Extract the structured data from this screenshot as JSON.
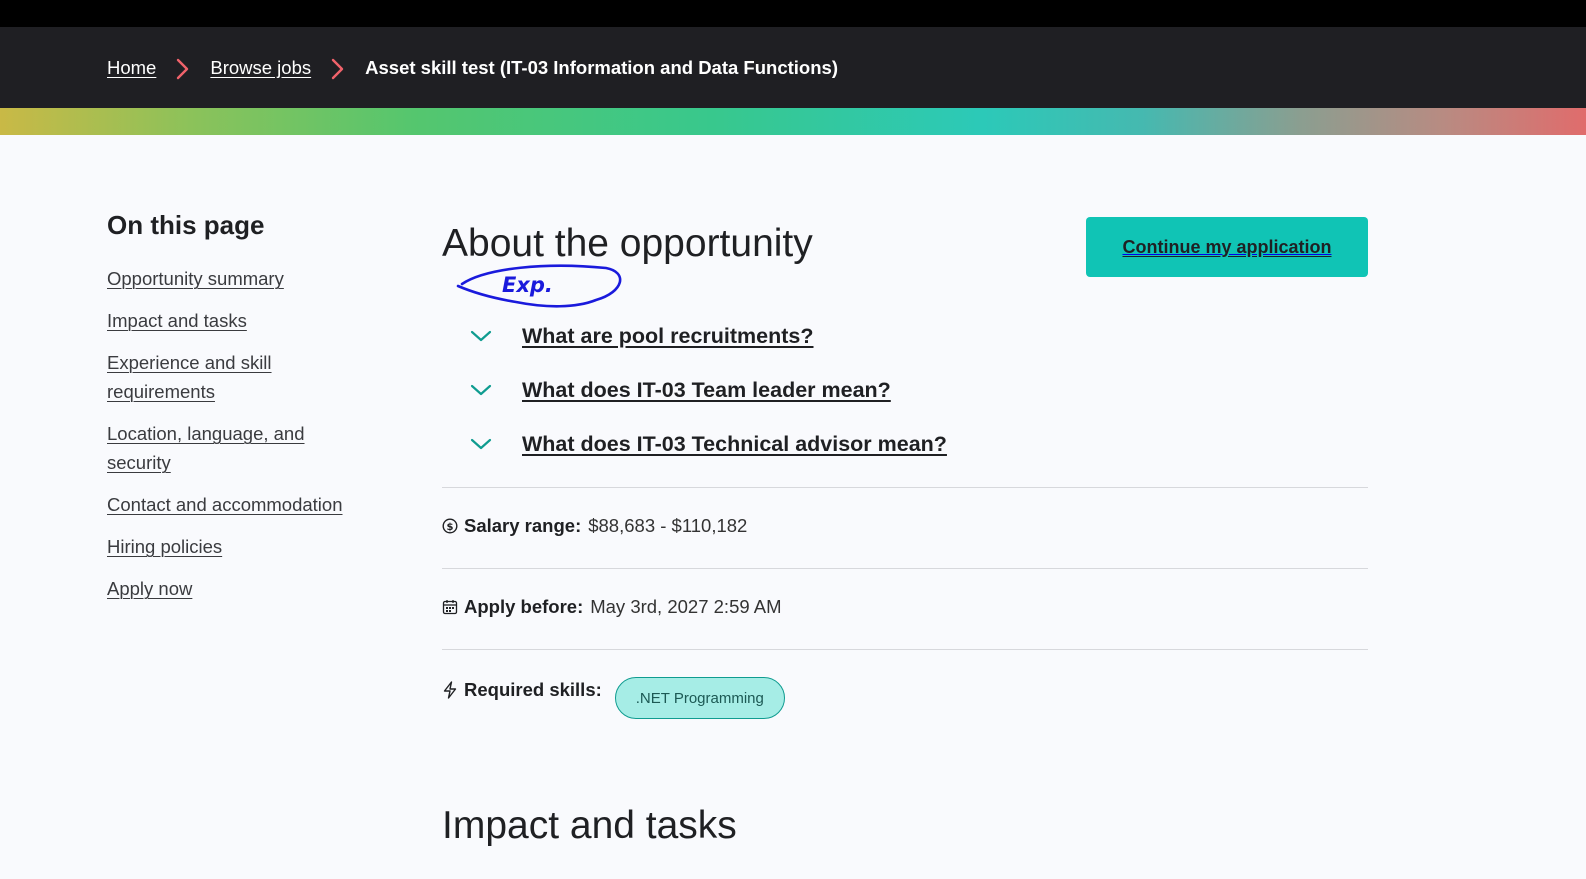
{
  "breadcrumb": {
    "home": "Home",
    "browse": "Browse jobs",
    "current": "Asset skill test (IT-03 Information and Data Functions)"
  },
  "sidebar": {
    "heading": "On this page",
    "items": [
      {
        "label": "Opportunity summary"
      },
      {
        "label": "Impact and tasks"
      },
      {
        "label": "Experience and skill requirements"
      },
      {
        "label": "Location, language, and security"
      },
      {
        "label": "Contact and accommodation"
      },
      {
        "label": "Hiring policies"
      },
      {
        "label": "Apply now"
      }
    ]
  },
  "main": {
    "title": "About the opportunity",
    "cta_label": "Continue my application",
    "annotation_text": "Exp.",
    "accordion": [
      {
        "label": "What are pool recruitments?"
      },
      {
        "label": "What does IT-03 Team leader mean?"
      },
      {
        "label": "What does IT-03 Technical advisor mean?"
      }
    ],
    "salary": {
      "label": "Salary range:",
      "value": "$88,683 - $110,182",
      "icon": "dollar-circle-icon"
    },
    "deadline": {
      "label": "Apply before:",
      "value": "May 3rd, 2027 2:59 AM",
      "icon": "calendar-icon"
    },
    "skills": {
      "label": "Required skills:",
      "items": [
        ".NET Programming"
      ],
      "icon": "bolt-icon"
    },
    "next_section_title": "Impact and tasks"
  },
  "colors": {
    "header_bg": "#1f1f23",
    "accent": "#10c4b5",
    "chip_bg": "#a6ede6",
    "crumb_separator": "#f0626b",
    "chevron": "#0f9c90",
    "annotation": "#1a1adc"
  }
}
